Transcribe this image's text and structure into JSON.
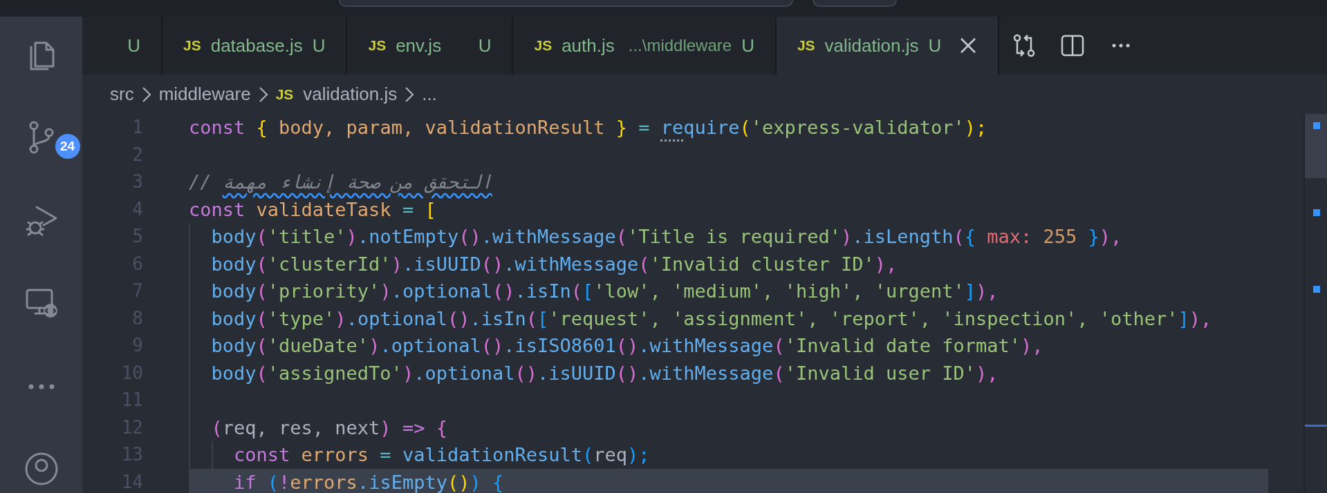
{
  "tabs": [
    {
      "status": "U",
      "selected": false
    },
    {
      "icon": "JS",
      "label": "database.js",
      "status": "U",
      "selected": false
    },
    {
      "icon": "JS",
      "label": "env.js",
      "status": "U",
      "selected": false
    },
    {
      "icon": "JS",
      "label": "auth.js",
      "description": "...\\middleware",
      "status": "U",
      "selected": false
    },
    {
      "icon": "JS",
      "label": "validation.js",
      "status": "U",
      "selected": true
    }
  ],
  "activity_bar": {
    "badge": "24"
  },
  "breadcrumb": [
    {
      "label": "src"
    },
    {
      "label": "middleware"
    },
    {
      "icon": "JS",
      "label": "validation.js"
    },
    {
      "label": "..."
    }
  ],
  "lines": [
    {
      "n": "1",
      "current": false,
      "code": [
        {
          "text": "const ",
          "kind": "kw"
        },
        {
          "text": "{ ",
          "kind": "b1"
        },
        {
          "text": "body, ",
          "kind": "var"
        },
        {
          "text": "param, ",
          "kind": "var"
        },
        {
          "text": "validationResult ",
          "kind": "var"
        },
        {
          "text": "} ",
          "kind": "b1"
        },
        {
          "text": "= ",
          "kind": "op"
        },
        {
          "text": "re",
          "kind": "hint"
        },
        {
          "text": "quire",
          "kind": "fn"
        },
        {
          "text": "(",
          "kind": "b1"
        },
        {
          "text": "'express-validator'",
          "kind": "str"
        },
        {
          "text": ");",
          "kind": "b1"
        }
      ]
    },
    {
      "n": "2",
      "current": false
    },
    {
      "n": "3",
      "current": false,
      "code": [
        {
          "text": "// ",
          "kind": "cm"
        },
        {
          "text": "التحقق من صحة إنشاء مهمة",
          "kind": "misspelled"
        }
      ]
    },
    {
      "n": "4",
      "current": false,
      "code": [
        {
          "text": "const ",
          "kind": "kw"
        },
        {
          "text": "validateTask ",
          "kind": "var"
        },
        {
          "text": "= ",
          "kind": "op"
        },
        {
          "text": "[",
          "kind": "b1"
        }
      ]
    },
    {
      "n": "5",
      "current": false,
      "code": [
        {
          "text": "  body",
          "kind": "fn"
        },
        {
          "text": "(",
          "kind": "b2"
        },
        {
          "text": "'title'",
          "kind": "str"
        },
        {
          "text": ")",
          "kind": "b2"
        },
        {
          "text": ".notEmpty",
          "kind": "fn"
        },
        {
          "text": "()",
          "kind": "b2"
        },
        {
          "text": ".withMessage",
          "kind": "fn"
        },
        {
          "text": "(",
          "kind": "b2"
        },
        {
          "text": "'Title is required'",
          "kind": "str"
        },
        {
          "text": ")",
          "kind": "b2"
        },
        {
          "text": ".isLength",
          "kind": "fn"
        },
        {
          "text": "(",
          "kind": "b2"
        },
        {
          "text": "{ ",
          "kind": "b3"
        },
        {
          "text": "max: ",
          "kind": "prop"
        },
        {
          "text": "255 ",
          "kind": "num"
        },
        {
          "text": "}",
          "kind": "b3"
        },
        {
          "text": "),",
          "kind": "b2"
        }
      ]
    },
    {
      "n": "6",
      "current": false,
      "code": [
        {
          "text": "  body",
          "kind": "fn"
        },
        {
          "text": "(",
          "kind": "b2"
        },
        {
          "text": "'clusterId'",
          "kind": "str"
        },
        {
          "text": ")",
          "kind": "b2"
        },
        {
          "text": ".isUUID",
          "kind": "fn"
        },
        {
          "text": "()",
          "kind": "b2"
        },
        {
          "text": ".withMessage",
          "kind": "fn"
        },
        {
          "text": "(",
          "kind": "b2"
        },
        {
          "text": "'Invalid cluster ID'",
          "kind": "str"
        },
        {
          "text": "),",
          "kind": "b2"
        }
      ]
    },
    {
      "n": "7",
      "current": false,
      "code": [
        {
          "text": "  body",
          "kind": "fn"
        },
        {
          "text": "(",
          "kind": "b2"
        },
        {
          "text": "'priority'",
          "kind": "str"
        },
        {
          "text": ")",
          "kind": "b2"
        },
        {
          "text": ".optional",
          "kind": "fn"
        },
        {
          "text": "()",
          "kind": "b2"
        },
        {
          "text": ".isIn",
          "kind": "fn"
        },
        {
          "text": "(",
          "kind": "b2"
        },
        {
          "text": "[",
          "kind": "b3"
        },
        {
          "text": "'low', 'medium', 'high', 'urgent'",
          "kind": "str"
        },
        {
          "text": "]",
          "kind": "b3"
        },
        {
          "text": "),",
          "kind": "b2"
        }
      ]
    },
    {
      "n": "8",
      "current": false,
      "code": [
        {
          "text": "  body",
          "kind": "fn"
        },
        {
          "text": "(",
          "kind": "b2"
        },
        {
          "text": "'type'",
          "kind": "str"
        },
        {
          "text": ")",
          "kind": "b2"
        },
        {
          "text": ".optional",
          "kind": "fn"
        },
        {
          "text": "()",
          "kind": "b2"
        },
        {
          "text": ".isIn",
          "kind": "fn"
        },
        {
          "text": "(",
          "kind": "b2"
        },
        {
          "text": "[",
          "kind": "b3"
        },
        {
          "text": "'request', 'assignment', 'report', 'inspection', 'other'",
          "kind": "str"
        },
        {
          "text": "]",
          "kind": "b3"
        },
        {
          "text": "),",
          "kind": "b2"
        }
      ]
    },
    {
      "n": "9",
      "current": false,
      "code": [
        {
          "text": "  body",
          "kind": "fn"
        },
        {
          "text": "(",
          "kind": "b2"
        },
        {
          "text": "'dueDate'",
          "kind": "str"
        },
        {
          "text": ")",
          "kind": "b2"
        },
        {
          "text": ".optional",
          "kind": "fn"
        },
        {
          "text": "()",
          "kind": "b2"
        },
        {
          "text": ".isISO8601",
          "kind": "fn"
        },
        {
          "text": "()",
          "kind": "b2"
        },
        {
          "text": ".withMessage",
          "kind": "fn"
        },
        {
          "text": "(",
          "kind": "b2"
        },
        {
          "text": "'Invalid date format'",
          "kind": "str"
        },
        {
          "text": "),",
          "kind": "b2"
        }
      ]
    },
    {
      "n": "10",
      "current": false,
      "code": [
        {
          "text": "  body",
          "kind": "fn"
        },
        {
          "text": "(",
          "kind": "b2"
        },
        {
          "text": "'assignedTo'",
          "kind": "str"
        },
        {
          "text": ")",
          "kind": "b2"
        },
        {
          "text": ".optional",
          "kind": "fn"
        },
        {
          "text": "()",
          "kind": "b2"
        },
        {
          "text": ".isUUID",
          "kind": "fn"
        },
        {
          "text": "()",
          "kind": "b2"
        },
        {
          "text": ".withMessage",
          "kind": "fn"
        },
        {
          "text": "(",
          "kind": "b2"
        },
        {
          "text": "'Invalid user ID'",
          "kind": "str"
        },
        {
          "text": "),",
          "kind": "b2"
        }
      ]
    },
    {
      "n": "11",
      "current": false
    },
    {
      "n": "12",
      "current": false,
      "code": [
        {
          "text": "  (",
          "kind": "b2"
        },
        {
          "text": "req, res, next",
          "kind": "p"
        },
        {
          "text": ") ",
          "kind": "b2"
        },
        {
          "text": "=> ",
          "kind": "kw"
        },
        {
          "text": "{",
          "kind": "b2"
        }
      ]
    },
    {
      "n": "13",
      "current": false,
      "code": [
        {
          "text": "    const ",
          "kind": "kw"
        },
        {
          "text": "errors ",
          "kind": "var"
        },
        {
          "text": "= ",
          "kind": "op"
        },
        {
          "text": "validationResult",
          "kind": "fn"
        },
        {
          "text": "(",
          "kind": "b3"
        },
        {
          "text": "req",
          "kind": "p"
        },
        {
          "text": ");",
          "kind": "b3"
        }
      ]
    },
    {
      "n": "14",
      "current": true,
      "code": [
        {
          "text": "    if ",
          "kind": "kw"
        },
        {
          "text": "(",
          "kind": "b3"
        },
        {
          "text": "!",
          "kind": "kw"
        },
        {
          "text": "errors",
          "kind": "var"
        },
        {
          "text": ".isEmpty",
          "kind": "fn"
        },
        {
          "text": "()",
          "kind": "b1"
        },
        {
          "text": ") {",
          "kind": "b3"
        }
      ]
    }
  ]
}
